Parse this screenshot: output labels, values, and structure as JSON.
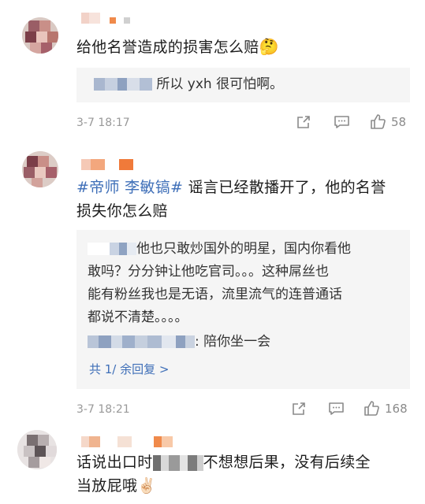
{
  "comments": [
    {
      "text": "给他名誉造成的损害怎么赔",
      "emoji": "🤔",
      "reply_text": "所以 yxh 很可怕啊。",
      "date": "3-7 18:17",
      "likes": "58"
    },
    {
      "tag": "#帝师 李敏镐#",
      "text_line1": " 谣言已经散播开了，他的名誉",
      "text_line2": "损失你怎么赔",
      "reply1_line1": "他也只敢炒国外的明星，国内你看他",
      "reply1_line2": "敢吗？分分钟让他吃官司。。。这种屌丝也",
      "reply1_line3": "能有粉丝我也是无语，流里流气的连普通话",
      "reply1_line4": "都说不清楚。。。。",
      "reply2_text": ": 陪你坐一会",
      "more_replies": "共 1/ 余回复 >",
      "date": "3-7 18:21",
      "likes": "168"
    },
    {
      "text_line1": "话说出口时",
      "text_line1_rest": "不想想后果，没有后续全",
      "text_line2": "当放屁哦",
      "emoji": "✌🏻"
    }
  ],
  "icons": {
    "share": "share-icon",
    "comment": "comment-icon",
    "like": "thumbs-up-icon"
  }
}
